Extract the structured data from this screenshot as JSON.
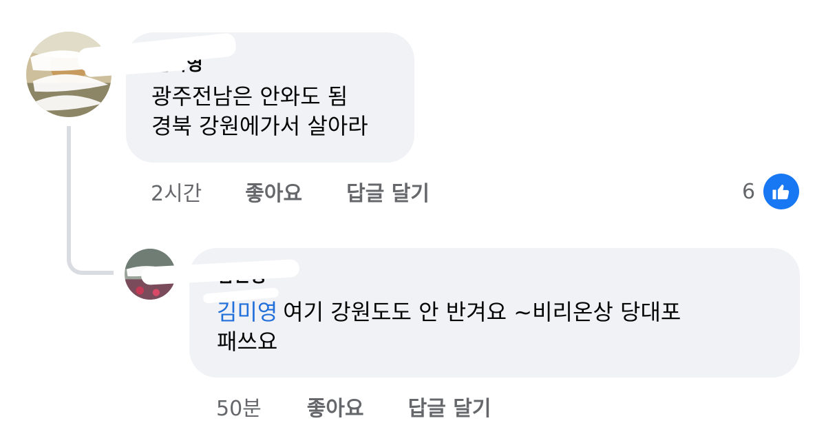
{
  "comments": [
    {
      "author": "김미영",
      "text_lines": [
        "광주전남은 안와도 됨",
        "경북 강원에가서 살아라"
      ],
      "time": "2시간",
      "like_label": "좋아요",
      "reply_label": "답글 달기",
      "reaction_count": "6",
      "reaction_icon": "thumbs-up-icon",
      "reaction_color": "#1877f2"
    },
    {
      "author": "김민정",
      "mention": "김미영",
      "text_line1": "여기 강원도도 안 반겨요 ~비리온상 당대포",
      "text_line2": "패쓰요",
      "time": "50분",
      "like_label": "좋아요",
      "reply_label": "답글 달기"
    }
  ],
  "colors": {
    "bubble": "#f0f2f5",
    "meta_text": "#65676b",
    "mention": "#216fdb",
    "thread_line": "#d9dce1"
  }
}
